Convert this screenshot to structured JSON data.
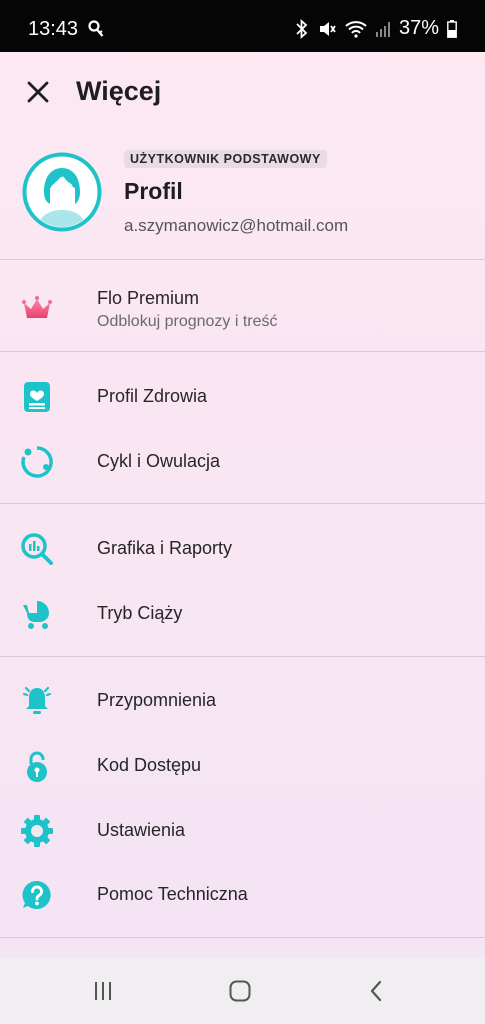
{
  "status_bar": {
    "time": "13:43",
    "battery": "37%"
  },
  "header": {
    "title": "Więcej"
  },
  "profile": {
    "badge": "UŻYTKOWNIK PODSTAWOWY",
    "name": "Profil",
    "email": "a.szymanowicz@hotmail.com"
  },
  "premium": {
    "label": "Flo Premium",
    "sublabel": "Odblokuj prognozy i treść"
  },
  "menu": {
    "health_profile": "Profil Zdrowia",
    "cycle": "Cykl i Owulacja",
    "graphics": "Grafika i Raporty",
    "pregnancy": "Tryb Ciąży",
    "reminders": "Przypomnienia",
    "access_code": "Kod Dostępu",
    "settings": "Ustawienia",
    "support": "Pomoc Techniczna"
  },
  "colors": {
    "accent": "#1ec3c9",
    "premium": "#f0577e",
    "background": "#fbe8f2"
  }
}
